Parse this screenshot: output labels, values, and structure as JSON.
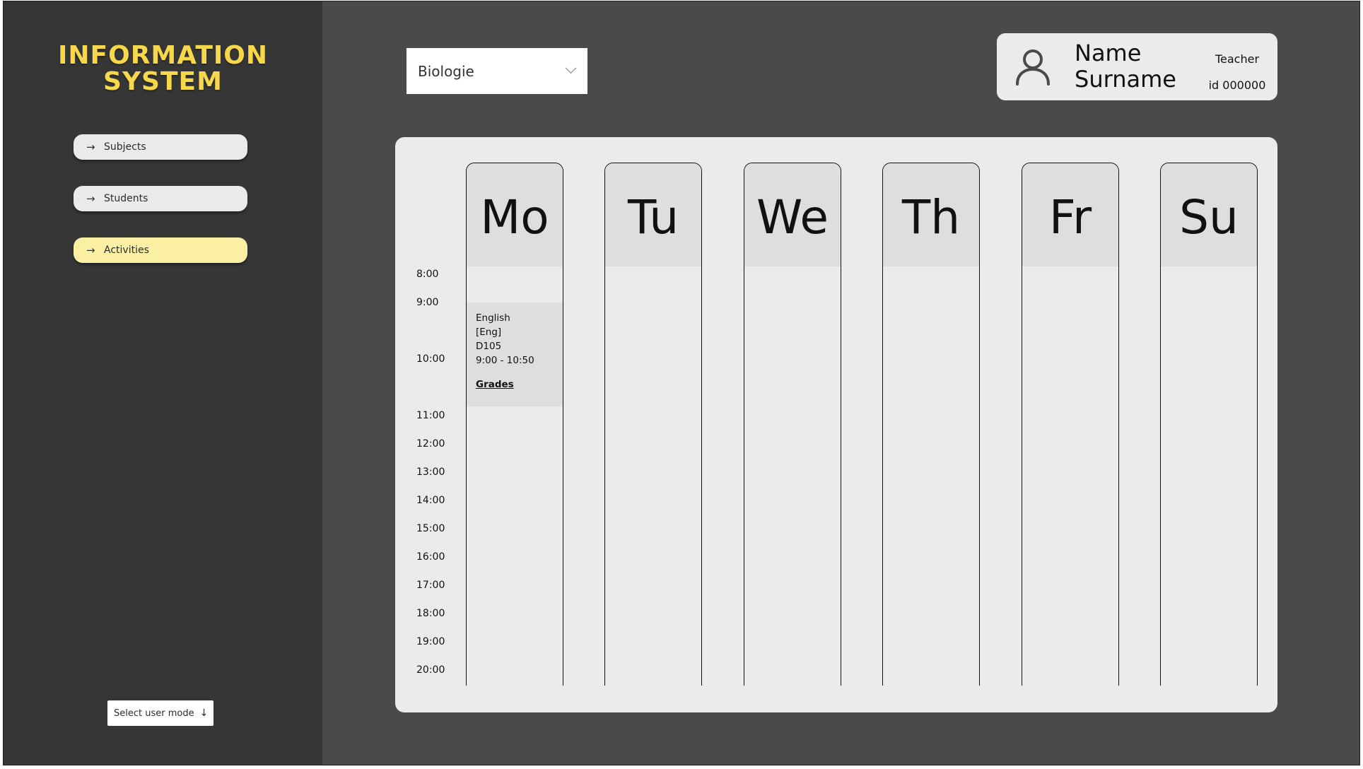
{
  "app": {
    "logo_line1": "INFORMATION",
    "logo_line2": "SYSTEM"
  },
  "sidebar": {
    "items": [
      {
        "label": "Subjects",
        "active": false
      },
      {
        "label": "Students",
        "active": false
      },
      {
        "label": "Activities",
        "active": true
      }
    ],
    "user_mode_label": "Select user mode"
  },
  "subject_select": {
    "value": "Biologie"
  },
  "user": {
    "name": "Name",
    "surname": "Surname",
    "role": "Teacher",
    "id": "id 000000"
  },
  "schedule": {
    "times": [
      "8:00",
      "9:00",
      "10:00",
      "11:00",
      "12:00",
      "13:00",
      "14:00",
      "15:00",
      "16:00",
      "17:00",
      "18:00",
      "19:00",
      "20:00"
    ],
    "days": [
      "Mo",
      "Tu",
      "We",
      "Th",
      "Fr",
      "Su"
    ],
    "events": [
      {
        "day": "Mo",
        "subject": "English",
        "code": "[Eng]",
        "room": "D105",
        "time": "9:00 - 10:50",
        "link": "Grades"
      }
    ]
  },
  "colors": {
    "background": "#4a4a4a",
    "sidebar": "#363636",
    "accent": "#f6d84a",
    "active_nav": "#fbefa3",
    "card": "#ebebeb",
    "day_header": "#dedede"
  }
}
